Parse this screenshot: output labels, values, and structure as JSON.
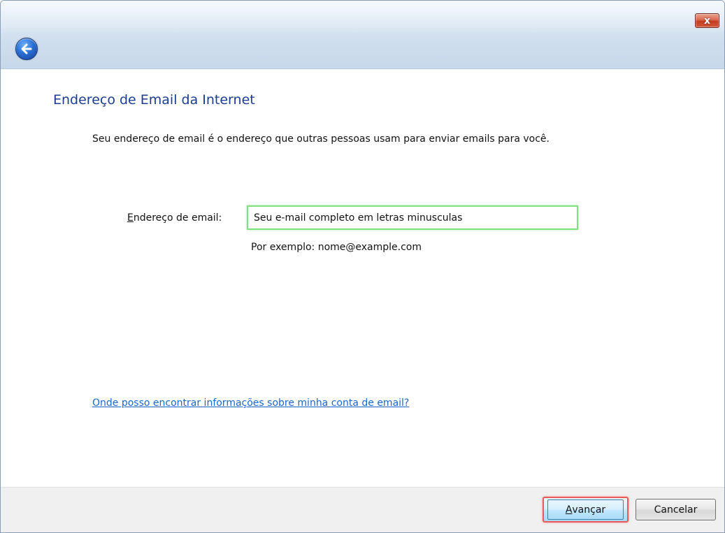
{
  "window": {
    "close_symbol": "x"
  },
  "header": {
    "back_icon": "back-arrow-icon"
  },
  "main": {
    "heading": "Endereço de Email da Internet",
    "description": "Seu endereço de email é o endereço que outras pessoas usam para enviar emails para você.",
    "field_label_accel": "E",
    "field_label_rest": "ndereço de email:",
    "email_value": "Seu e-mail completo em letras minusculas",
    "example": "Por exemplo: nome@example.com",
    "help_link": "Onde posso encontrar informações sobre minha conta de email?"
  },
  "footer": {
    "next_accel": "A",
    "next_rest": "vançar",
    "cancel_label": "Cancelar"
  },
  "colors": {
    "heading": "#1c3d8f",
    "link": "#1a66cc",
    "input_focus": "#7fe07f",
    "highlight": "#e95a5a"
  }
}
